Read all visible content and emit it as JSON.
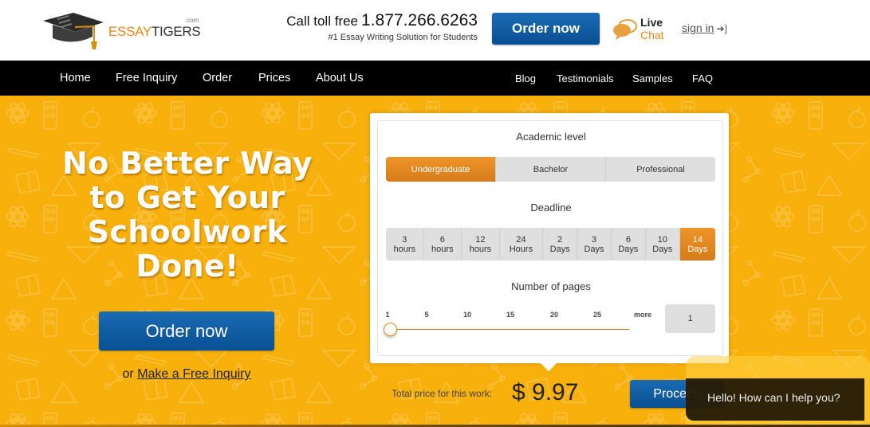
{
  "header": {
    "logo": {
      "brand_part1": "ESSAY",
      "brand_part2": "TIGERS",
      "suffix": ".com",
      "icon": "graduation-cap-icon"
    },
    "call_label": "Call toll free",
    "phone": "1.877.266.6263",
    "tagline": "#1 Essay Writing Solution for Students",
    "order_button": "Order now",
    "live_chat": {
      "line1": "Live",
      "line2": "Chat",
      "icon": "chat-bubbles-icon"
    },
    "sign_in": {
      "label": "sign in",
      "icon": "sign-in-icon"
    }
  },
  "nav": {
    "left": [
      "Home",
      "Free Inquiry",
      "Order",
      "Prices",
      "About Us"
    ],
    "right": [
      "Blog",
      "Testimonials",
      "Samples",
      "FAQ"
    ]
  },
  "hero": {
    "headline_lines": [
      "No Better Way",
      "to Get Your",
      "Schoolwork",
      "Done!"
    ],
    "order_button": "Order now",
    "inquiry_prefix": "or",
    "inquiry_link": "Make a Free Inquiry"
  },
  "calculator": {
    "academic_level": {
      "title": "Academic level",
      "options": [
        "Undergraduate",
        "Bachelor",
        "Professional"
      ],
      "selected": "Undergraduate"
    },
    "deadline": {
      "title": "Deadline",
      "options": [
        {
          "value": "3",
          "unit": "hours"
        },
        {
          "value": "6",
          "unit": "hours"
        },
        {
          "value": "12",
          "unit": "hours"
        },
        {
          "value": "24",
          "unit": "Hours"
        },
        {
          "value": "2",
          "unit": "Days"
        },
        {
          "value": "3",
          "unit": "Days"
        },
        {
          "value": "6",
          "unit": "Days"
        },
        {
          "value": "10",
          "unit": "Days"
        },
        {
          "value": "14",
          "unit": "Days"
        }
      ],
      "selected_index": 8
    },
    "pages": {
      "title": "Number of pages",
      "ticks": [
        "1",
        "5",
        "10",
        "15",
        "20",
        "25"
      ],
      "more_label": "more",
      "value": "1",
      "slider_min": 1,
      "slider_max": 28,
      "slider_value": 1
    },
    "total_label": "Total price for this work:",
    "price": "$ 9.97",
    "proceed_button": "Proceed"
  },
  "chat_widget": {
    "message": "Hello! How can I help you?"
  },
  "colors": {
    "brand_orange": "#e8891c",
    "hero_yellow": "#f8b10c",
    "button_blue": "#0a4f94",
    "nav_black": "#000000"
  }
}
